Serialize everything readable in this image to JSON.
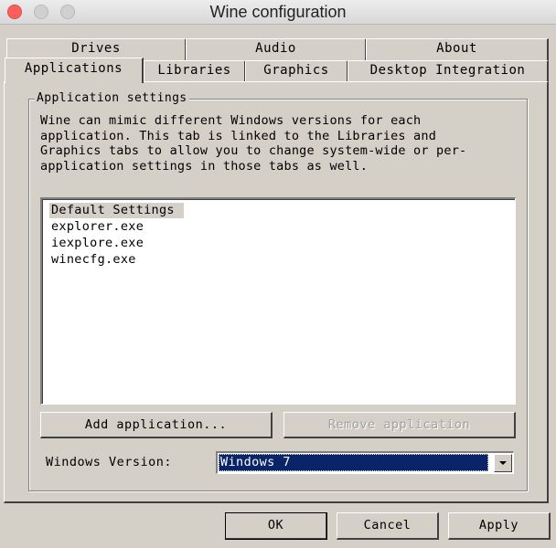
{
  "window": {
    "title": "Wine configuration"
  },
  "tabs": {
    "row_back": [
      "Drives",
      "Audio",
      "About"
    ],
    "row_front": [
      "Applications",
      "Libraries",
      "Graphics",
      "Desktop Integration"
    ],
    "active": "Applications"
  },
  "app_settings": {
    "group_title": "Application settings",
    "description": "Wine can mimic different Windows versions for each\napplication. This tab is linked to the Libraries and\nGraphics tabs to allow you to change system-wide or per-\napplication settings in those tabs as well.",
    "applications": [
      "Default Settings",
      "explorer.exe",
      "iexplore.exe",
      "winecfg.exe"
    ],
    "selected_application": "Default Settings",
    "add_button": "Add application...",
    "remove_button": "Remove application",
    "windows_version_label": "Windows Version:",
    "windows_version_value": "Windows 7"
  },
  "buttons": {
    "ok": "OK",
    "cancel": "Cancel",
    "apply": "Apply"
  }
}
